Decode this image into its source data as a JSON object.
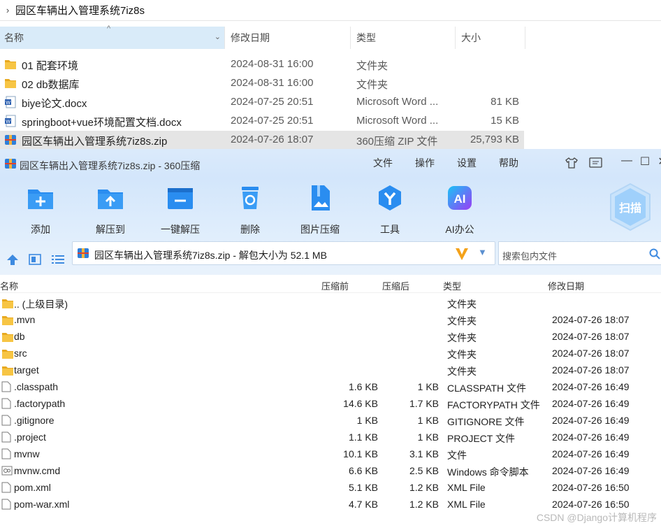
{
  "explorer": {
    "breadcrumb": "园区车辆出入管理系统7iz8s",
    "columns": [
      "名称",
      "修改日期",
      "类型",
      "大小"
    ],
    "rows": [
      {
        "name": "01 配套环境",
        "date": "2024-08-31 16:00",
        "type": "文件夹",
        "size": "",
        "icon": "folder-icon"
      },
      {
        "name": "02 db数据库",
        "date": "2024-08-31 16:00",
        "type": "文件夹",
        "size": "",
        "icon": "folder-icon"
      },
      {
        "name": "biye论文.docx",
        "date": "2024-07-25 20:51",
        "type": "Microsoft Word ...",
        "size": "81 KB",
        "icon": "word-doc-icon"
      },
      {
        "name": "springboot+vue环境配置文档.docx",
        "date": "2024-07-25 20:51",
        "type": "Microsoft Word ...",
        "size": "15 KB",
        "icon": "word-doc-icon"
      },
      {
        "name": "园区车辆出入管理系统7iz8s.zip",
        "date": "2024-07-26 18:07",
        "type": "360压缩 ZIP 文件",
        "size": "25,793 KB",
        "icon": "zip-archive-icon"
      }
    ]
  },
  "zipwin": {
    "title": "园区车辆出入管理系统7iz8s.zip - 360压缩",
    "menu": [
      "文件",
      "操作",
      "设置",
      "帮助"
    ],
    "tools": [
      "添加",
      "解压到",
      "一键解压",
      "删除",
      "图片压缩",
      "工具",
      "AI办公"
    ],
    "scan_label": "扫描",
    "ai_badge": "AI",
    "address": "园区车辆出入管理系统7iz8s.zip - 解包大小为 52.1 MB",
    "search_placeholder": "搜索包内文件",
    "columns": [
      "名称",
      "压缩前",
      "压缩后",
      "类型",
      "修改日期"
    ],
    "rows": [
      {
        "name": ".. (上级目录)",
        "before": "",
        "after": "",
        "type": "文件夹",
        "date": "",
        "icon": "folder-icon"
      },
      {
        "name": ".mvn",
        "before": "",
        "after": "",
        "type": "文件夹",
        "date": "2024-07-26 18:07",
        "icon": "folder-icon"
      },
      {
        "name": "db",
        "before": "",
        "after": "",
        "type": "文件夹",
        "date": "2024-07-26 18:07",
        "icon": "folder-icon"
      },
      {
        "name": "src",
        "before": "",
        "after": "",
        "type": "文件夹",
        "date": "2024-07-26 18:07",
        "icon": "folder-icon"
      },
      {
        "name": "target",
        "before": "",
        "after": "",
        "type": "文件夹",
        "date": "2024-07-26 18:07",
        "icon": "folder-icon"
      },
      {
        "name": ".classpath",
        "before": "1.6 KB",
        "after": "1 KB",
        "type": "CLASSPATH 文件",
        "date": "2024-07-26 16:49",
        "icon": "file-icon"
      },
      {
        "name": ".factorypath",
        "before": "14.6 KB",
        "after": "1.7 KB",
        "type": "FACTORYPATH 文件",
        "date": "2024-07-26 16:49",
        "icon": "file-icon"
      },
      {
        "name": ".gitignore",
        "before": "1 KB",
        "after": "1 KB",
        "type": "GITIGNORE 文件",
        "date": "2024-07-26 16:49",
        "icon": "file-icon"
      },
      {
        "name": ".project",
        "before": "1.1 KB",
        "after": "1 KB",
        "type": "PROJECT 文件",
        "date": "2024-07-26 16:49",
        "icon": "file-icon"
      },
      {
        "name": "mvnw",
        "before": "10.1 KB",
        "after": "3.1 KB",
        "type": "文件",
        "date": "2024-07-26 16:49",
        "icon": "file-icon"
      },
      {
        "name": "mvnw.cmd",
        "before": "6.6 KB",
        "after": "2.5 KB",
        "type": "Windows 命令脚本",
        "date": "2024-07-26 16:49",
        "icon": "cmd-script-icon"
      },
      {
        "name": "pom.xml",
        "before": "5.1 KB",
        "after": "1.2 KB",
        "type": "XML File",
        "date": "2024-07-26 16:50",
        "icon": "file-icon"
      },
      {
        "name": "pom-war.xml",
        "before": "4.7 KB",
        "after": "1.2 KB",
        "type": "XML File",
        "date": "2024-07-26 16:50",
        "icon": "file-icon"
      }
    ]
  },
  "watermark": "CSDN @Django计算机程序",
  "colors": {
    "accent": "#2c8ef0",
    "toolbar_bg": "#d6e8fb",
    "selection": "#e5e5e5",
    "header_selected": "#d9ebf9"
  }
}
